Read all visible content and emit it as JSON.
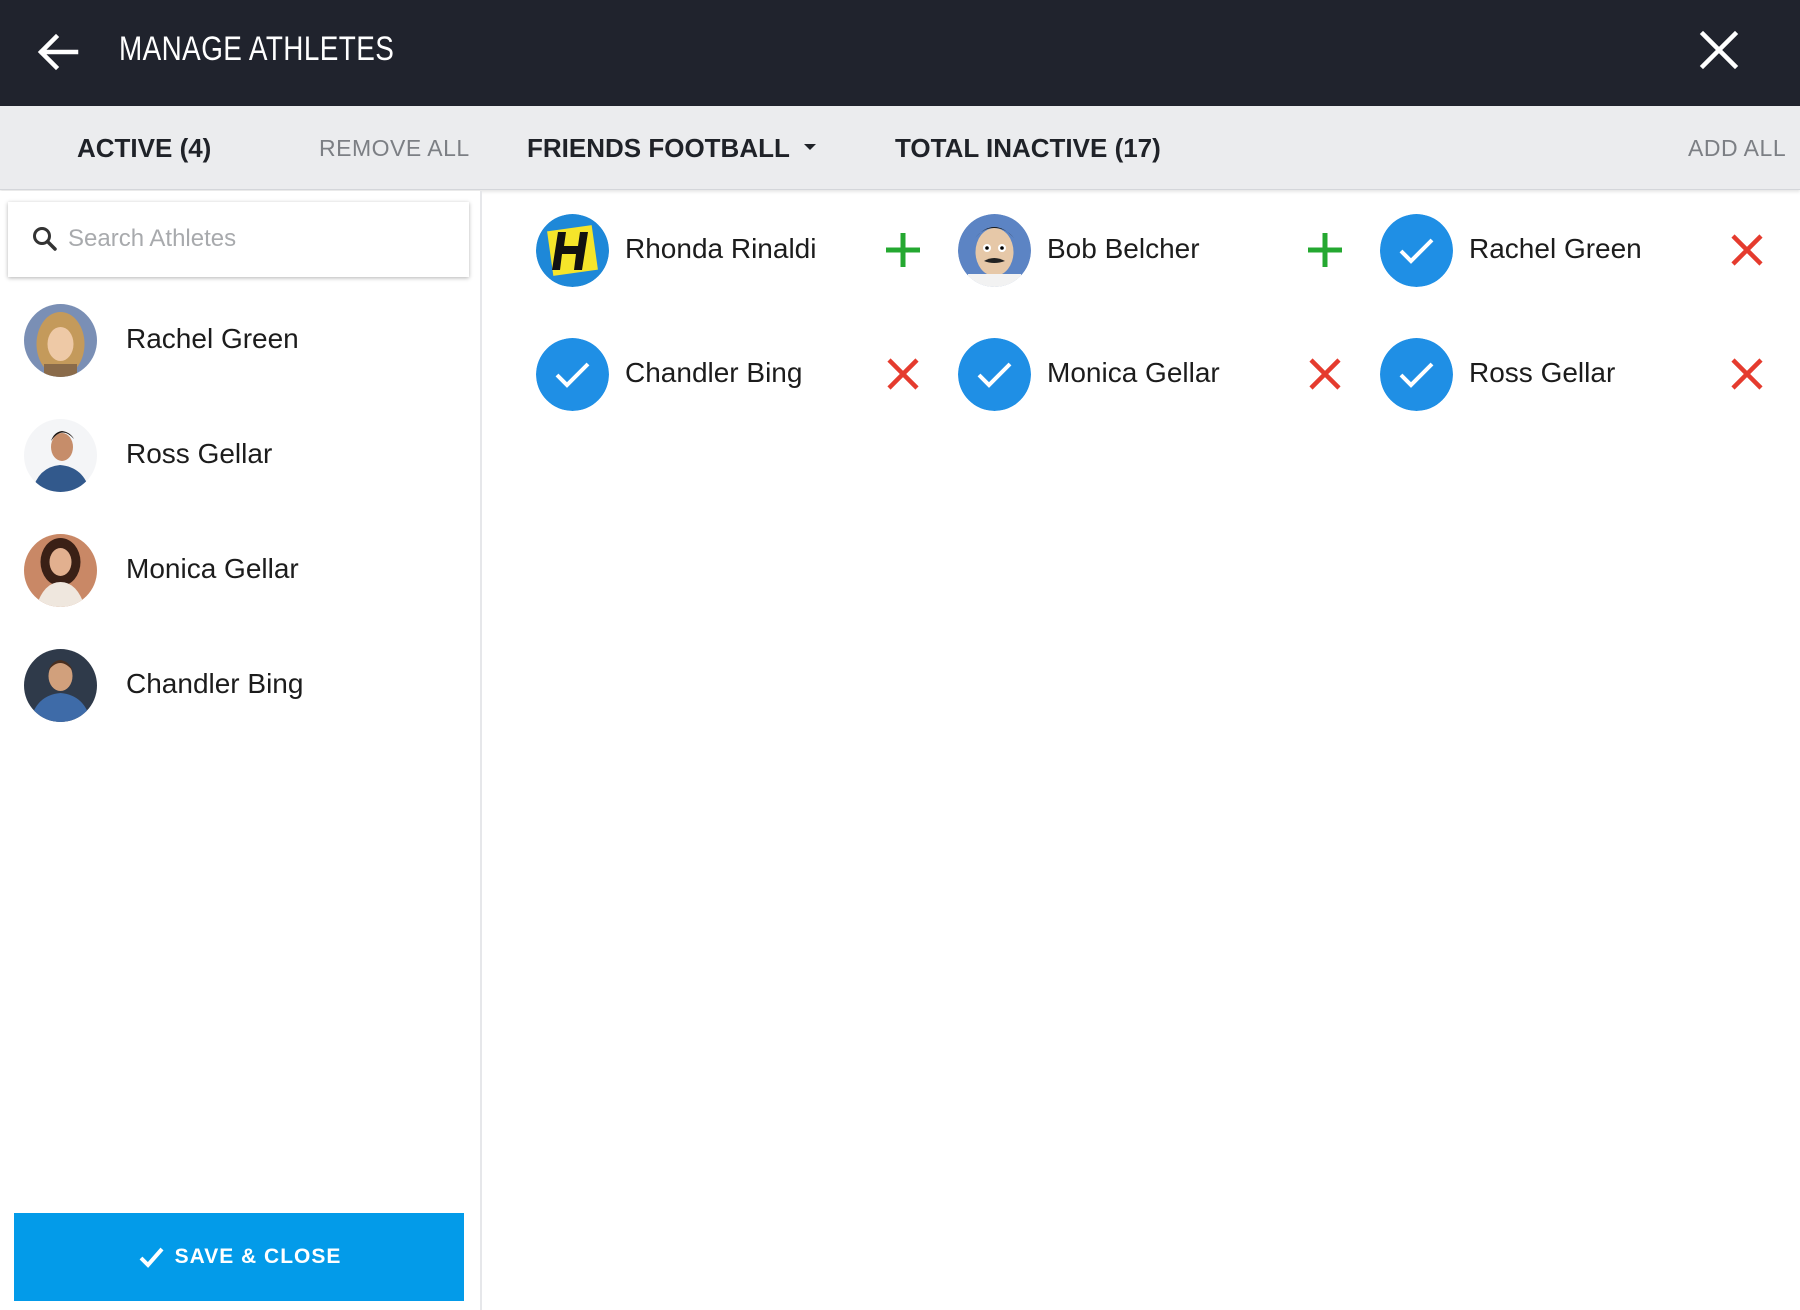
{
  "header": {
    "title": "MANAGE ATHLETES",
    "back_icon": "arrow-left-icon",
    "close_icon": "close-icon"
  },
  "subheader": {
    "active_label": "ACTIVE (4)",
    "remove_all": "REMOVE ALL",
    "team": "FRIENDS FOOTBALL",
    "inactive_label": "TOTAL INACTIVE (17)",
    "add_all": "ADD ALL"
  },
  "search": {
    "placeholder": "Search Athletes",
    "value": ""
  },
  "active_athletes": [
    {
      "name": "Rachel Green"
    },
    {
      "name": "Ross Gellar"
    },
    {
      "name": "Monica Gellar"
    },
    {
      "name": "Chandler Bing"
    }
  ],
  "roster": [
    {
      "name": "Rhonda Rinaldi",
      "selected": false,
      "action": "add-icon"
    },
    {
      "name": "Bob Belcher",
      "selected": false,
      "action": "add-icon"
    },
    {
      "name": "Rachel Green",
      "selected": true,
      "action": "remove-icon"
    },
    {
      "name": "Chandler Bing",
      "selected": true,
      "action": "remove-icon"
    },
    {
      "name": "Monica Gellar",
      "selected": true,
      "action": "remove-icon"
    },
    {
      "name": "Ross Gellar",
      "selected": true,
      "action": "remove-icon"
    }
  ],
  "save_button": {
    "label": "SAVE & CLOSE"
  },
  "colors": {
    "topbar": "#20232d",
    "subbar": "#ebecee",
    "accent": "#039be9",
    "add": "#24a830",
    "remove": "#e53b2e"
  }
}
